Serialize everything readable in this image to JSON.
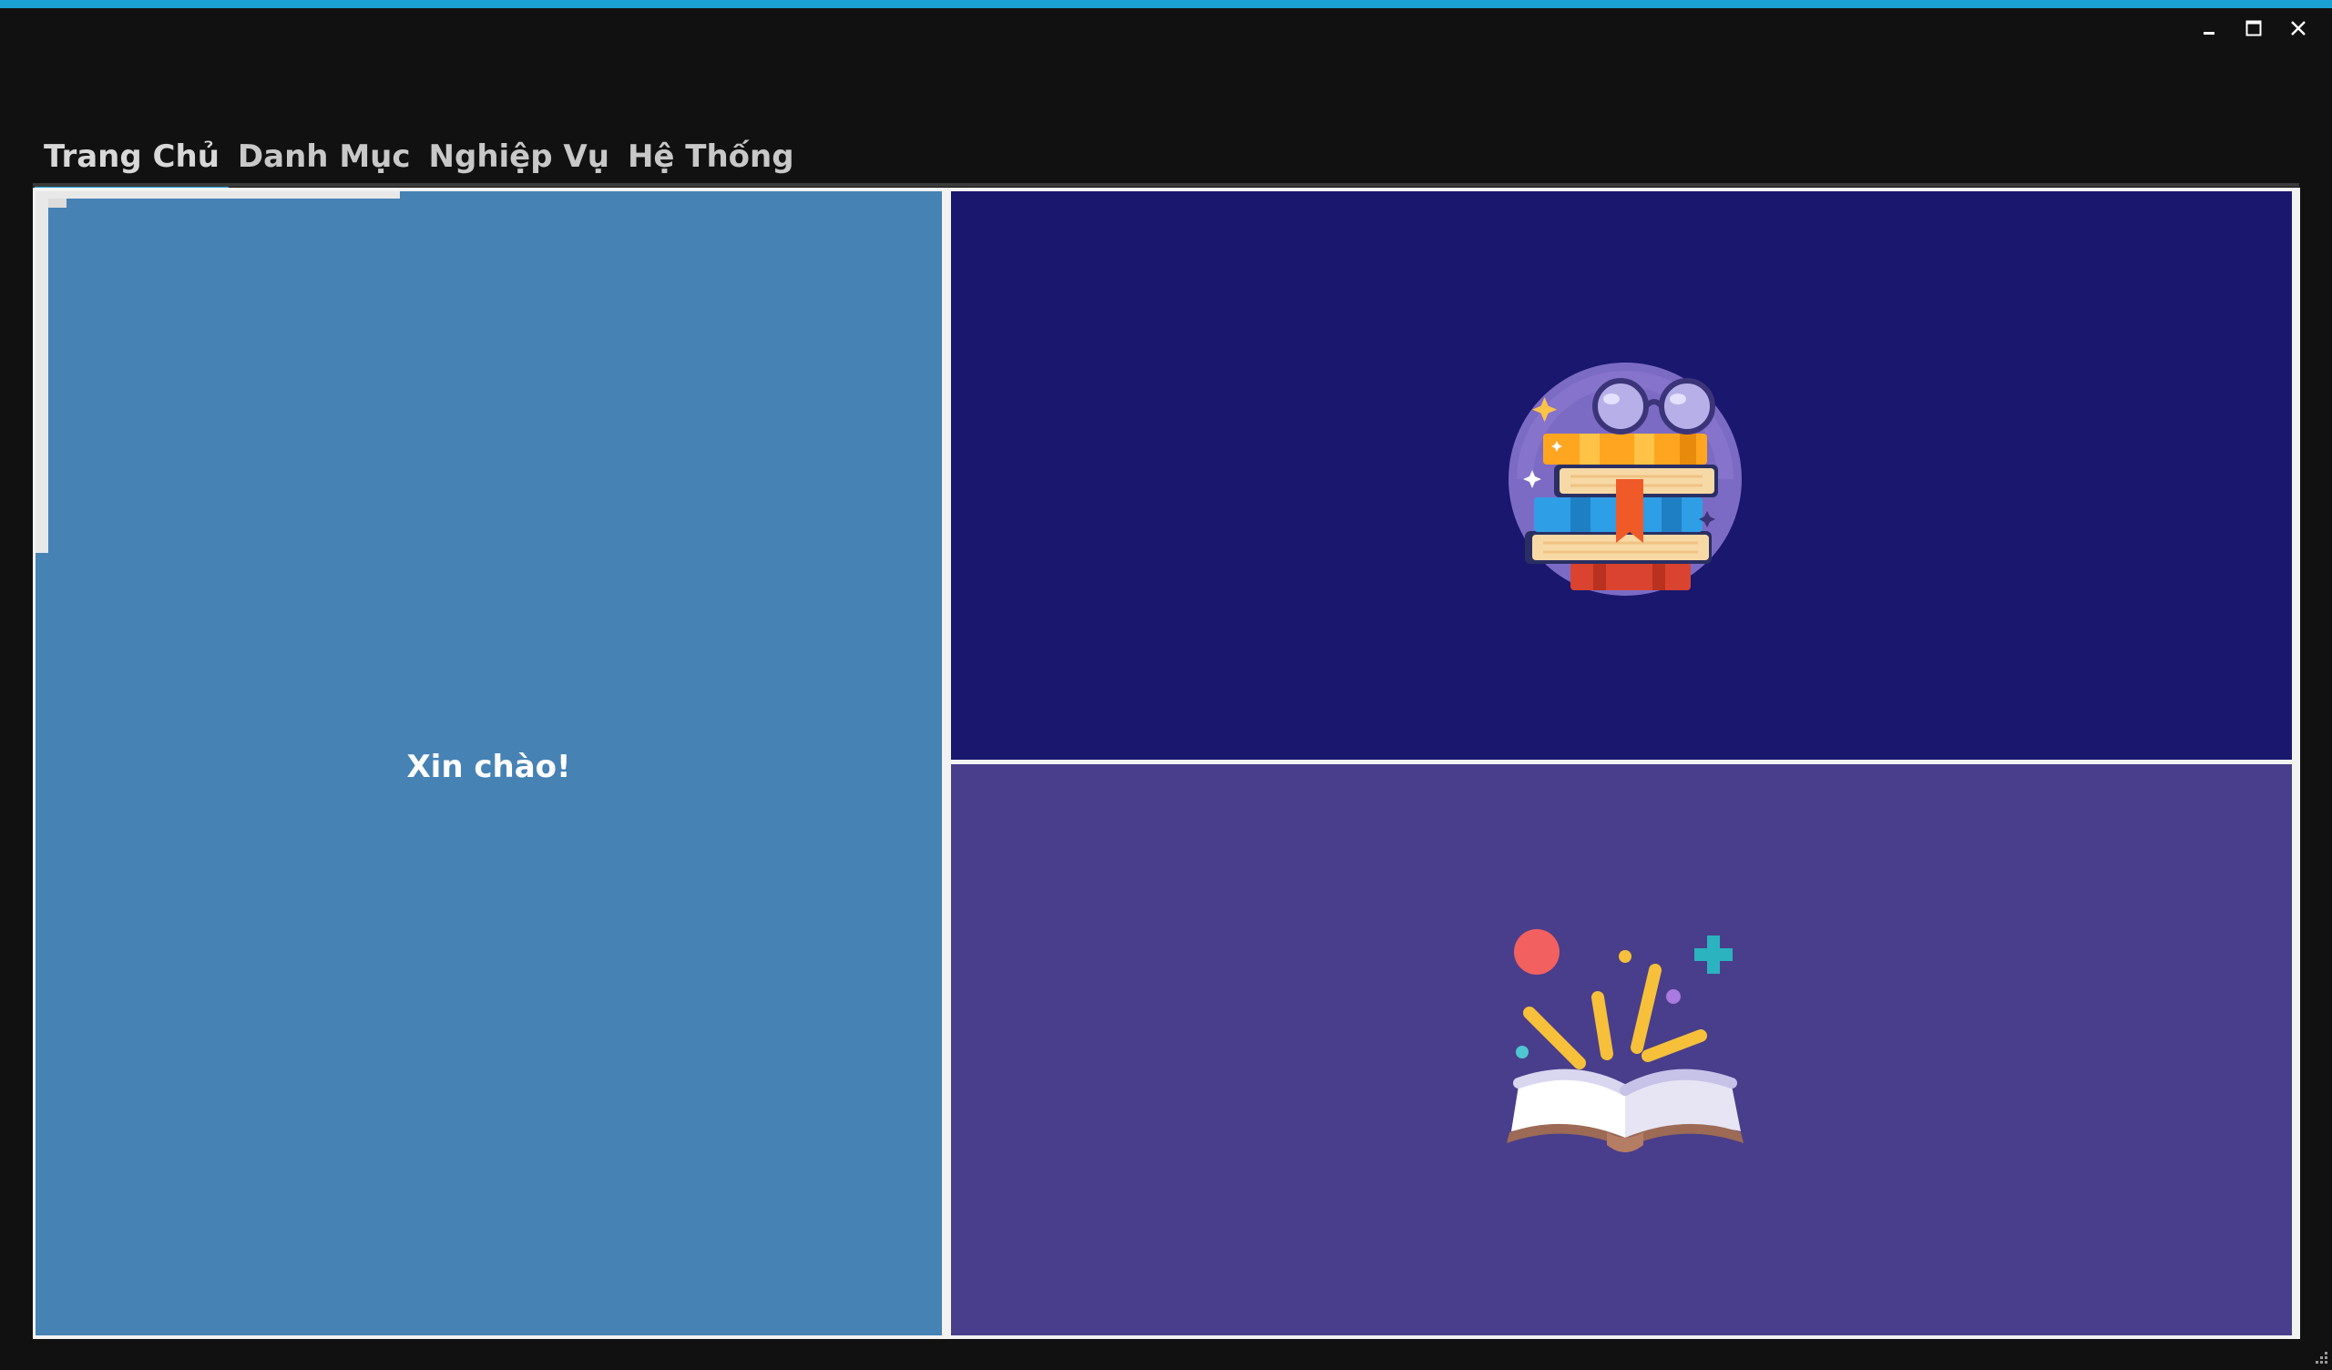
{
  "window": {
    "accent_color": "#1aa0d2",
    "controls": [
      "minimize-icon",
      "maximize-icon",
      "close-icon"
    ]
  },
  "tabs": [
    {
      "label": "Trang Chủ",
      "active": true
    },
    {
      "label": "Danh Mục",
      "active": false
    },
    {
      "label": "Nghiệp Vụ",
      "active": false
    },
    {
      "label": "Hệ Thống",
      "active": false
    }
  ],
  "home": {
    "greeting": "Xin chào!",
    "left_panel_color": "#4682b4",
    "right_top_color": "#19176e",
    "right_bottom_color": "#493e8b",
    "illustrations": [
      "books-stack-icon",
      "open-book-icon"
    ]
  }
}
